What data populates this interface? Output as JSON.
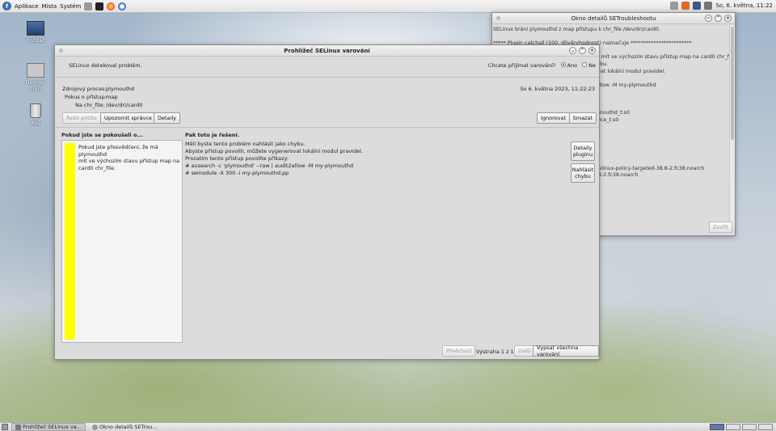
{
  "top_panel": {
    "menu": [
      "Aplikace",
      "Místa",
      "Systém"
    ],
    "clock": "So, 6. května, 11:22"
  },
  "desktop_icons": [
    "Počítač",
    "Domov: com",
    "Koš"
  ],
  "details_window": {
    "title": "Okno detailů SETroubleshootu",
    "lines": [
      "SELinux brání plymouthd z map přístupu k chr_file /dev/dri/card0.",
      "",
      "*****  Plugin catchall (100. důvěryhodnost)  naznačuje   ************************",
      "",
      "Pokud jste přesvědčeni, že má plymouthd mít ve výchozím stavu přístup map na card0 chr_file.",
      "Pak byste tento problém nahlásit jako chybu.",
      "Abyste přístup povolili, můžete vygenerovat lokální modul pravidel.",
      "",
      "# ausearch -c 'plymouthd' --raw | audit2allow -M my-plymouthd",
      "",
      "",
      "",
      "Zdrojový kontext: system_u:system_r:plymouthd_t:s0",
      "Cílový kontext: system_u:object_r:dri_device_t:s0",
      "Cíl: /dev/dri/card0 [ chr_file ]",
      "",
      "",
      "",
      "",
      "",
      "RPM zdroje: plymouth-22.02.122-5.fc38 selinux-policy-targeted-38.8-2.fc38.noarch",
      "RPM pravidel: selinux-policy-targeted-38.8-2.fc38.noarch"
    ],
    "close_button": "Zavřít"
  },
  "main_window": {
    "title": "Prohlížeč SELinux varování",
    "header_text": "SELinux detekoval problém.",
    "receive_question": "Chcete přijímat varování?",
    "yes": "Ano",
    "no": "Ne",
    "source_process_label": "Zdrojový proces:",
    "source_process": "plymouthd",
    "access_label": "Pokus o přístup:",
    "access": "map",
    "target_label": "Na chr_file:",
    "target": "/dev/dri/card0",
    "timestamp": "So 6. května 2023, 11:22:23",
    "buttons": {
      "fix": "Řešit potíže",
      "notify_admin": "Upozornit správce",
      "details": "Detaily",
      "ignore": "Ignorovat",
      "delete": "Smazat"
    },
    "left_heading": "Pokud jste se pokoušeli o...",
    "left_text": [
      "Pokud jste přesvědčeni, že má plymouthd",
      "mít ve výchozím stavu přístup map na",
      "card0 chr_file."
    ],
    "right_heading": "Pak toto je řešení.",
    "right_lines": [
      "Měli byste tento problém nahlásit jako chybu.",
      "Abyste přístup povolili, můžete vygenerovat lokální modul pravidel.",
      "Prozatím tento přístup povolíte příkazy:",
      "# ausearch -c 'plymouthd' --raw | audit2allow -M my-plymouthd",
      "# semodule -X 300 -i my-plymouthd.pp"
    ],
    "plugin_details": [
      "Detaily",
      "pluginu"
    ],
    "report_bug": [
      "Nahlásit",
      "chybu"
    ],
    "prev": "Předchozí",
    "counter": "Výstraha 1 z 1",
    "next": "Další",
    "list_all": "Vypsat všechna varování"
  },
  "taskbar": {
    "tasks": [
      "Prohlížeč SELinux va...",
      "Okno detailů SETrou..."
    ]
  },
  "colors": {
    "accent": "#2a62c4",
    "severity": "#ffff00"
  }
}
